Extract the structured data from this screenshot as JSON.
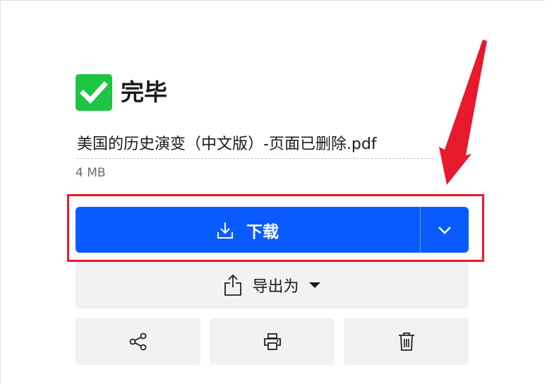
{
  "status": {
    "icon": "checkmark-icon",
    "title": "完毕",
    "color": "#1ec443"
  },
  "file": {
    "name": "美国的历史演变（中文版）-页面已删除.pdf",
    "size": "4 MB"
  },
  "download": {
    "icon": "download-icon",
    "label": "下载",
    "more_icon": "chevron-down-icon",
    "color": "#0a5bff"
  },
  "export": {
    "icon": "upload-export-icon",
    "label": "导出为",
    "caret_icon": "caret-down-icon"
  },
  "actions": [
    {
      "icon": "share-icon"
    },
    {
      "icon": "print-icon"
    },
    {
      "icon": "trash-icon"
    }
  ],
  "annotation": {
    "color": "#e8192c"
  }
}
